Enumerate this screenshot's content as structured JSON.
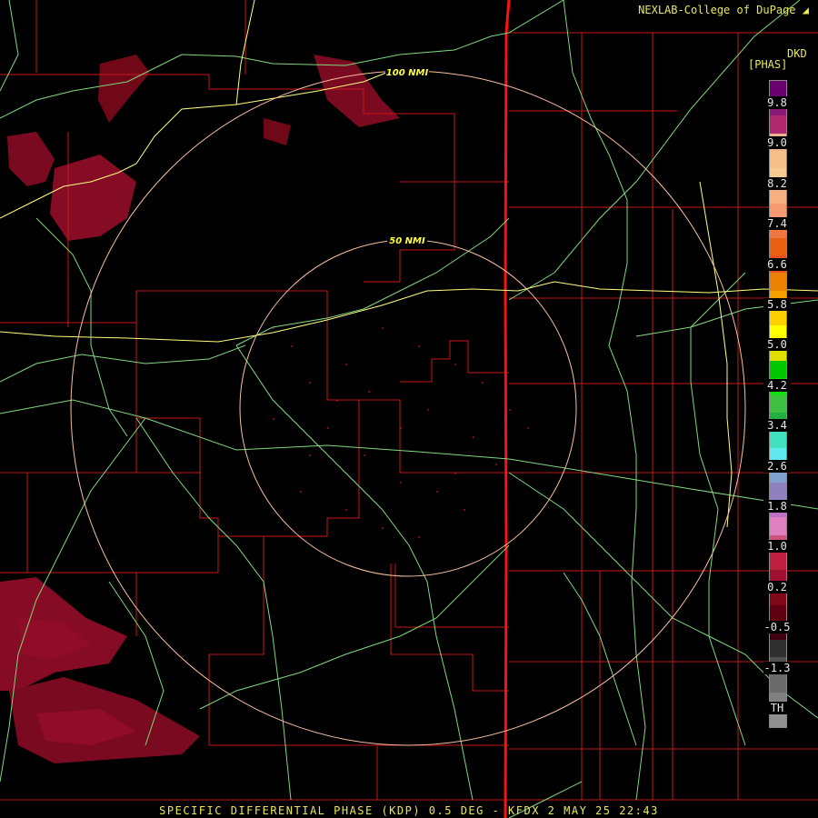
{
  "header": {
    "credit": "NEXLAB-College of DuPage",
    "credit_icon": "corner-logo-icon"
  },
  "footer": {
    "caption": "SPECIFIC DIFFERENTIAL PHASE (KDP) 0.5 DEG - KFDX 2 MAY 25 22:43"
  },
  "legend": {
    "unit_top": "DKD",
    "unit_sub": "[PHAS]",
    "ticks": [
      "9.8",
      "9.0",
      "8.2",
      "7.4",
      "6.6",
      "5.8",
      "5.0",
      "4.2",
      "3.4",
      "2.6",
      "1.8",
      "1.0",
      "0.2",
      "-0.5",
      "-1.3",
      "TH"
    ],
    "colors": [
      "#6a0070",
      "#8a1a7a",
      "#b02870",
      "#f0b090",
      "#f8c088",
      "#fac891",
      "#f8b080",
      "#f89870",
      "#f07840",
      "#e86010",
      "#e85020",
      "#ec8000",
      "#f8a000",
      "#ffd000",
      "#ffff00",
      "#e0e000",
      "#00c800",
      "#10e010",
      "#40c040",
      "#20b040",
      "#40e0c0",
      "#60e8f0",
      "#80a0d0",
      "#9080c0",
      "#c070c0",
      "#e080c0",
      "#d05080",
      "#c02040",
      "#a01030",
      "#800818",
      "#600010",
      "#400010",
      "#303030",
      "#505050",
      "#6a6a6a",
      "#808080",
      "#909090"
    ]
  },
  "map": {
    "rings": [
      "100 NMI",
      "50 NMI"
    ],
    "colors": {
      "state_line": "#ff1010",
      "county_line": "#d01818",
      "highway": "#80d880",
      "interstate": "#ffff80",
      "range_ring": "#f8c0a0",
      "echo": "#8a0a20"
    }
  }
}
